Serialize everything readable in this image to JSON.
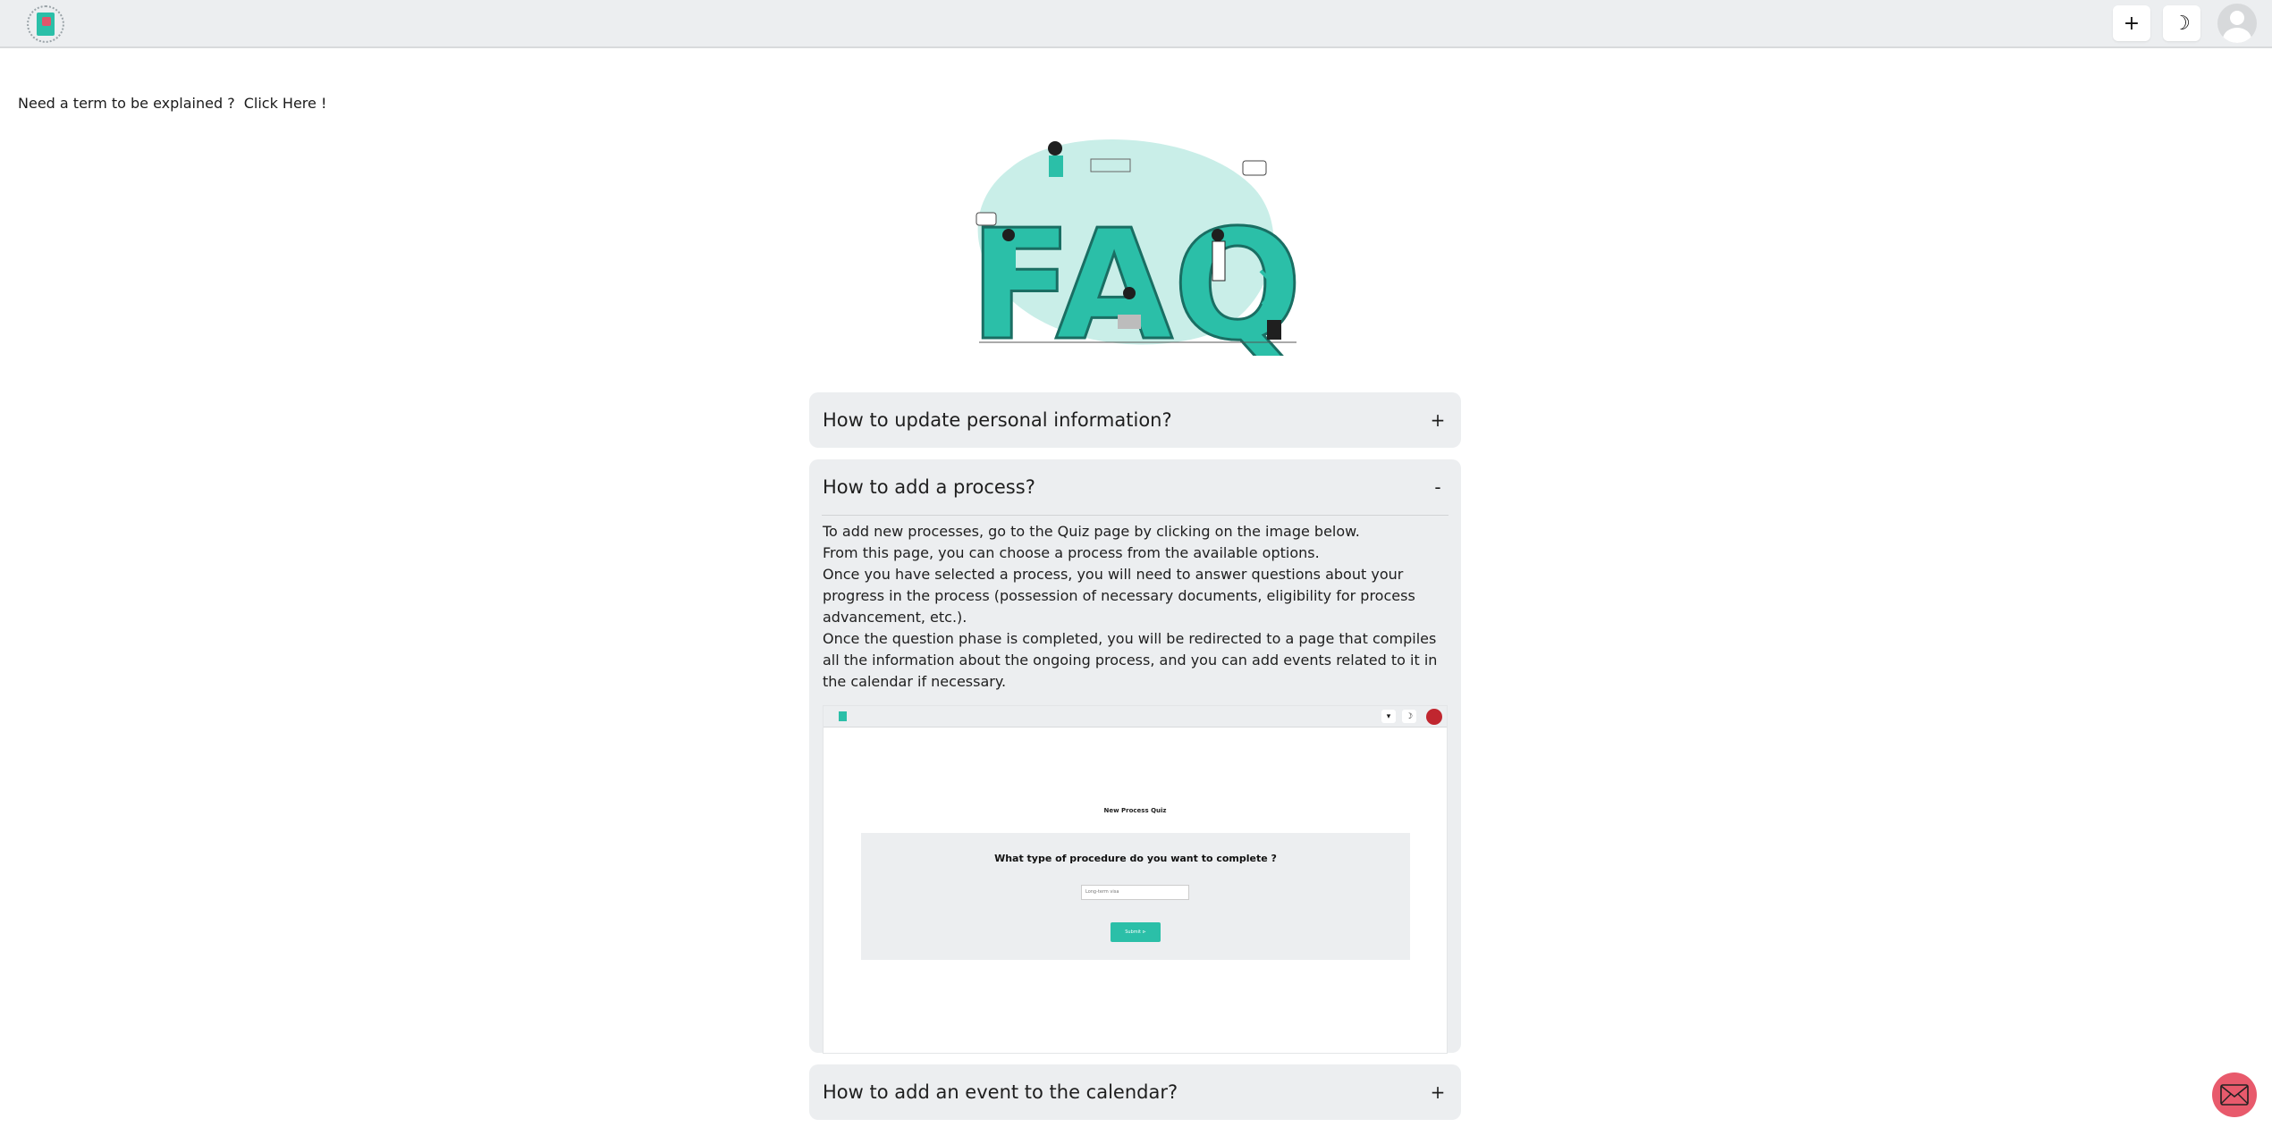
{
  "navbar": {
    "add_button": "+",
    "theme_button": "☽"
  },
  "help": {
    "prompt": "Need a term to be explained ?",
    "link": "Click Here !"
  },
  "hero": {
    "text": "FAQ"
  },
  "faq": {
    "items": [
      {
        "question": "How to update personal information?",
        "toggle": "+",
        "expanded": false
      },
      {
        "question": "How to add a process?",
        "toggle": "-",
        "expanded": true,
        "answer_lines": [
          "To add new processes, go to the Quiz page by clicking on the image below.",
          "From this page, you can choose a process from the available options.",
          "Once you have selected a process, you will need to answer questions about your progress in the process (possession of necessary documents, eligibility for process advancement, etc.).",
          "Once the question phase is completed, you will be redirected to a page that compiles all the information about the ongoing process, and you can add events related to it in the calendar if necessary."
        ],
        "screenshot": {
          "page_title": "New Process Quiz",
          "question": "What type of procedure do you want to complete ?",
          "select_value": "Long-term visa",
          "submit_label": "Submit ⊳"
        }
      },
      {
        "question": "How to add an event to the calendar?",
        "toggle": "+",
        "expanded": false
      }
    ]
  },
  "colors": {
    "accent": "#2bbfa8",
    "panel": "#eceef0",
    "mail_fab": "#e85a6c"
  }
}
